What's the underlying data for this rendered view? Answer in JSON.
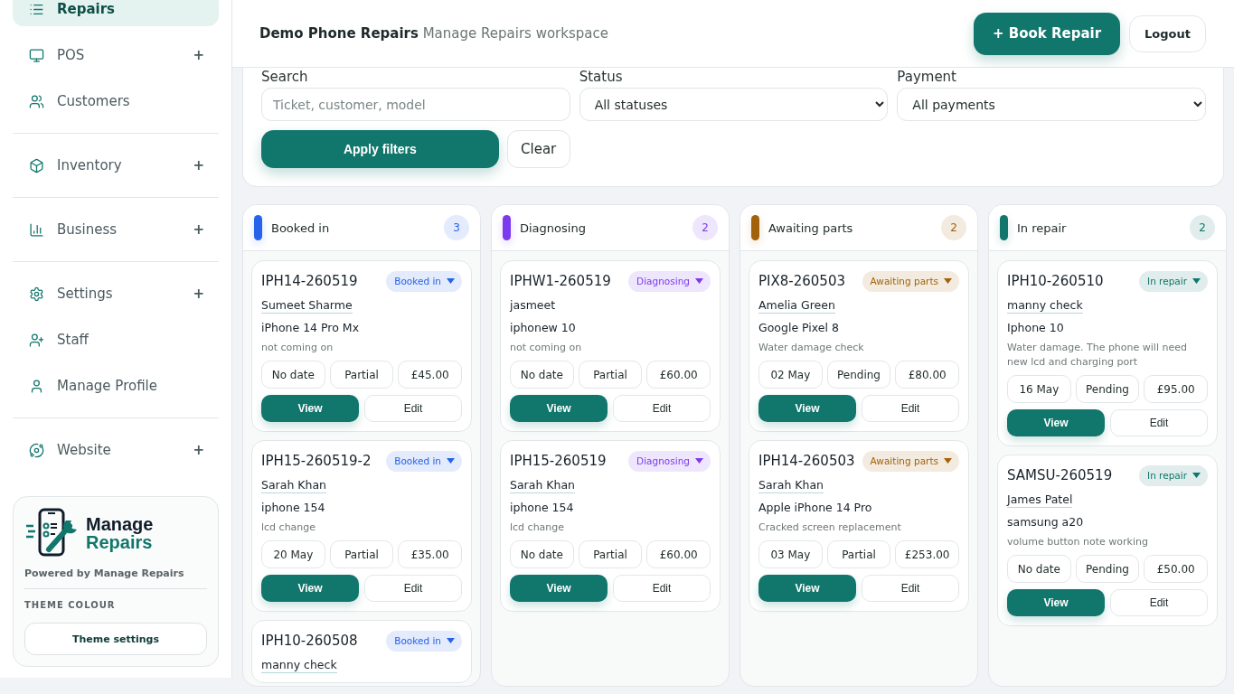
{
  "sidebar": {
    "groups": [
      {
        "items": [
          {
            "label": "Repairs",
            "selected": true
          },
          {
            "label": "POS",
            "selected": false,
            "toggle": "+"
          },
          {
            "label": "Customers",
            "selected": false
          }
        ]
      },
      {
        "items": [
          {
            "label": "Inventory",
            "selected": false,
            "toggle": "+"
          }
        ]
      },
      {
        "items": [
          {
            "label": "Business",
            "selected": false,
            "toggle": "+"
          }
        ]
      },
      {
        "items": [
          {
            "label": "Settings",
            "selected": false,
            "toggle": "+"
          },
          {
            "label": "Staff",
            "selected": false
          },
          {
            "label": "Manage Profile",
            "selected": false
          }
        ]
      },
      {
        "items": [
          {
            "label": "Website",
            "selected": false,
            "toggle": "+"
          }
        ]
      }
    ],
    "brand": {
      "logo_lines": [
        "Manage",
        "Repairs"
      ],
      "powered_by": "Powered by Manage Repairs",
      "section_title": "THEME COLOUR",
      "button": "Theme settings"
    }
  },
  "header": {
    "title": "Demo Phone Repairs",
    "subtitle": "Manage Repairs workspace",
    "primary_button": "+ Book Repair",
    "secondary_button": "Logout"
  },
  "filters": {
    "search": {
      "label": "Search",
      "placeholder": "Ticket, customer, model"
    },
    "status": {
      "label": "Status",
      "value": "All statuses"
    },
    "payment": {
      "label": "Payment",
      "value": "All payments"
    },
    "apply_button": "Apply filters",
    "clear_button": "Clear"
  },
  "columns": [
    {
      "title": "Booked in",
      "count": "3",
      "color": "#2563eb",
      "cards": [
        {
          "ticket": "IPH14-260519",
          "status": "Booked in",
          "customer": "Sumeet Sharme",
          "customer_linked": true,
          "device": "iPhone 14 Pro Mx",
          "issue": "not coming on",
          "date": "No date",
          "payment": "Partial",
          "price": "£45.00",
          "actions": [
            "View",
            "Edit"
          ]
        },
        {
          "ticket": "IPH15-260519-2",
          "status": "Booked in",
          "customer": "Sarah Khan",
          "customer_linked": true,
          "device": "iphone 154",
          "issue": "lcd change",
          "date": "20 May",
          "payment": "Partial",
          "price": "£35.00",
          "actions": [
            "View",
            "Edit"
          ]
        },
        {
          "ticket": "IPH10-260508",
          "status": "Booked in",
          "customer": "manny check",
          "customer_linked": true
        }
      ]
    },
    {
      "title": "Diagnosing",
      "count": "2",
      "color": "#7c3aed",
      "cards": [
        {
          "ticket": "IPHW1-260519",
          "status": "Diagnosing",
          "customer": "jasmeet",
          "customer_linked": false,
          "device": "iphonew 10",
          "issue": "not coming on",
          "date": "No date",
          "payment": "Partial",
          "price": "£60.00",
          "actions": [
            "View",
            "Edit"
          ]
        },
        {
          "ticket": "IPH15-260519",
          "status": "Diagnosing",
          "customer": "Sarah Khan",
          "customer_linked": true,
          "device": "iphone 154",
          "issue": "lcd change",
          "date": "No date",
          "payment": "Partial",
          "price": "£60.00",
          "actions": [
            "View",
            "Edit"
          ]
        }
      ]
    },
    {
      "title": "Awaiting parts",
      "count": "2",
      "color": "#a1620b",
      "cards": [
        {
          "ticket": "PIX8-260503",
          "status": "Awaiting parts",
          "customer": "Amelia Green",
          "customer_linked": true,
          "device": "Google Pixel 8",
          "issue": "Water damage check",
          "date": "02 May",
          "payment": "Pending",
          "price": "£80.00",
          "actions": [
            "View",
            "Edit"
          ]
        },
        {
          "ticket": "IPH14-260503",
          "status": "Awaiting parts",
          "customer": "Sarah Khan",
          "customer_linked": true,
          "device": "Apple iPhone 14 Pro",
          "issue": "Cracked screen replacement",
          "date": "03 May",
          "payment": "Partial",
          "price": "£253.00",
          "actions": [
            "View",
            "Edit"
          ]
        }
      ]
    },
    {
      "title": "In repair",
      "count": "2",
      "color": "#11766c",
      "cards": [
        {
          "ticket": "IPH10-260510",
          "status": "In repair",
          "customer": "manny check",
          "customer_linked": true,
          "device": "Iphone 10",
          "issue": "Water damage. The phone will need new lcd and charging port",
          "date": "16 May",
          "payment": "Pending",
          "price": "£95.00",
          "actions": [
            "View",
            "Edit"
          ]
        },
        {
          "ticket": "SAMSU-260519",
          "status": "In repair",
          "customer": "James Patel",
          "customer_linked": true,
          "device": "samsung a20",
          "issue": "volume button note working",
          "date": "No date",
          "payment": "Pending",
          "price": "£50.00",
          "actions": [
            "View",
            "Edit"
          ]
        }
      ]
    }
  ]
}
